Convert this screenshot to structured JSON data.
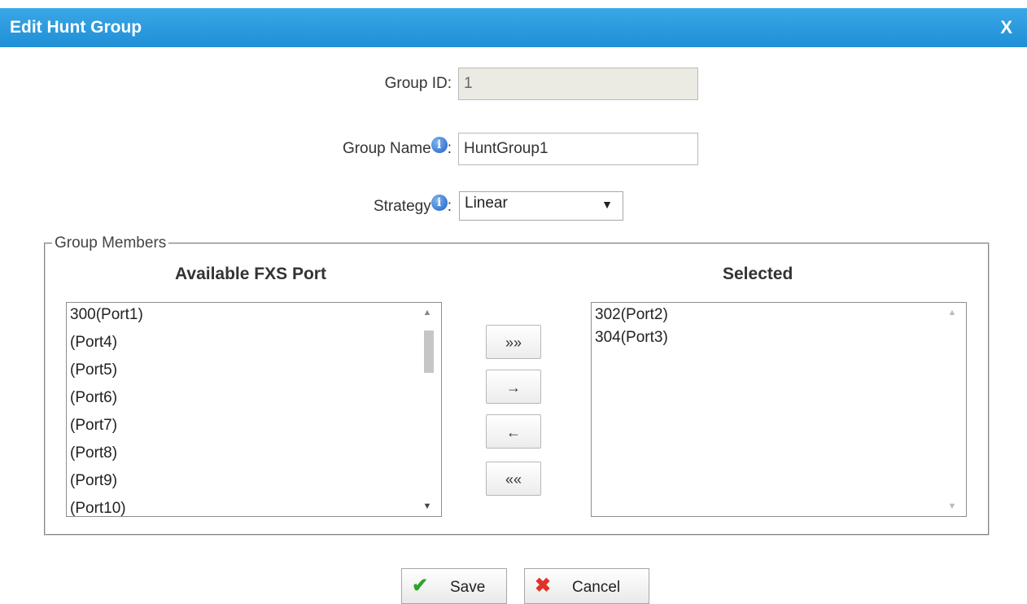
{
  "dialog": {
    "title": "Edit Hunt Group",
    "close_label": "X"
  },
  "form": {
    "group_id": {
      "label": "Group ID:",
      "value": "1"
    },
    "group_name": {
      "label": "Group Name",
      "suffix": ":",
      "value": "HuntGroup1"
    },
    "strategy": {
      "label": "Strategy",
      "suffix": ":",
      "value": "Linear"
    }
  },
  "members": {
    "legend": "Group Members",
    "available_title": "Available FXS Port",
    "selected_title": "Selected",
    "available": [
      "300(Port1)",
      "(Port4)",
      "(Port5)",
      "(Port6)",
      "(Port7)",
      "(Port8)",
      "(Port9)",
      "(Port10)"
    ],
    "selected": [
      "302(Port2)",
      "304(Port3)"
    ],
    "buttons": {
      "add_all": "»»",
      "add": "→",
      "remove": "←",
      "remove_all": "««"
    }
  },
  "actions": {
    "save": "Save",
    "cancel": "Cancel"
  },
  "icons": {
    "info": "i",
    "save_icon_color": "#2aa52a",
    "cancel_icon_color": "#e0322b"
  }
}
